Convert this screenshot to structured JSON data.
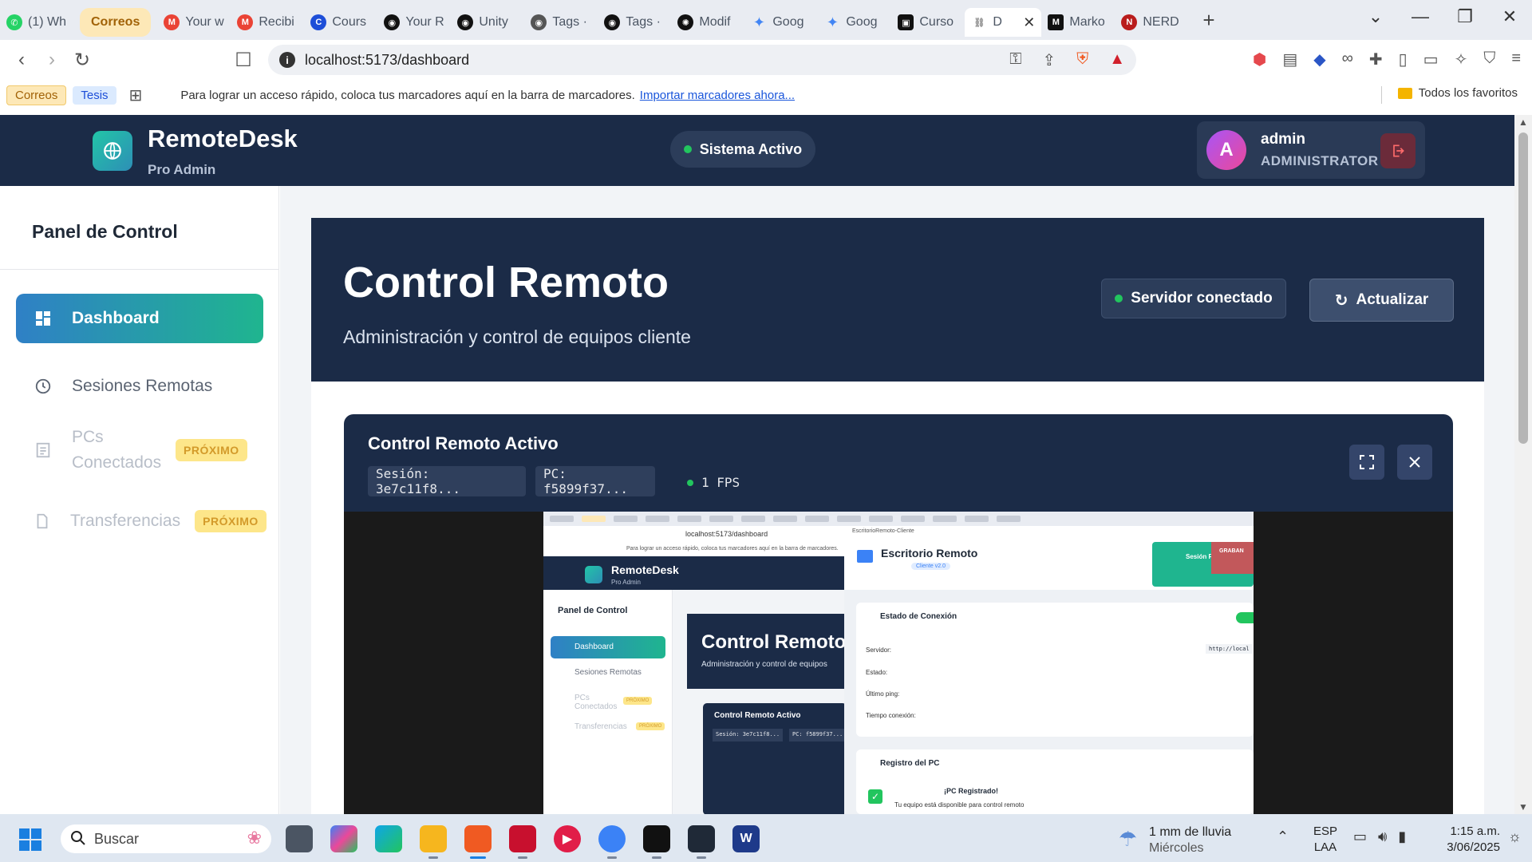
{
  "browser": {
    "tabs": [
      {
        "label": "(1) Wh",
        "icon": "whatsapp-icon",
        "color": "#25d366"
      },
      {
        "label": "Correos",
        "group": true
      },
      {
        "label": "Your w",
        "icon": "gmail-icon",
        "color": "#ea4335"
      },
      {
        "label": "Recibi",
        "icon": "gmail-icon",
        "color": "#ea4335"
      },
      {
        "label": "Cours",
        "icon": "coursera-icon",
        "color": "#1d4ed8"
      },
      {
        "label": "Your R",
        "icon": "github-icon",
        "color": "#111"
      },
      {
        "label": "Unity",
        "icon": "github-icon",
        "color": "#111"
      },
      {
        "label": "Tags ·",
        "icon": "github-icon",
        "color": "#555"
      },
      {
        "label": "Tags ·",
        "icon": "github-icon",
        "color": "#111"
      },
      {
        "label": "Modif",
        "icon": "openai-icon",
        "color": "#111"
      },
      {
        "label": "Goog",
        "icon": "gemini-icon",
        "color": "#4285f4"
      },
      {
        "label": "Goog",
        "icon": "gemini-icon",
        "color": "#4285f4"
      },
      {
        "label": "Curso",
        "icon": "cursor-icon",
        "color": "#111"
      },
      {
        "label": "D",
        "icon": "link-icon",
        "color": "#999",
        "active": true
      },
      {
        "label": "Marko",
        "icon": "medium-icon",
        "color": "#111"
      },
      {
        "label": "NERD",
        "icon": "nerd-icon",
        "color": "#b91c1c"
      }
    ],
    "url": "localhost:5173/dashboard",
    "bookmarks": {
      "chip1": "Correos",
      "chip2": "Tesis",
      "text": "Para lograr un acceso rápido, coloca tus marcadores aquí en la barra de marcadores.",
      "link": "Importar marcadores ahora...",
      "favorites": "Todos los favoritos"
    }
  },
  "header": {
    "brand": "RemoteDesk",
    "brand_sub": "Pro Admin",
    "status": "Sistema Activo",
    "user_initial": "A",
    "user_name": "admin",
    "user_role": "ADMINISTRATOR"
  },
  "sidebar": {
    "title": "Panel de Control",
    "items": [
      {
        "label": "Dashboard",
        "icon": "dashboard-icon",
        "active": true
      },
      {
        "label": "Sesiones Remotas",
        "icon": "clock-icon"
      },
      {
        "label": "PCs Conectados",
        "icon": "document-icon",
        "badge": "PRÓXIMO",
        "disabled": true
      },
      {
        "label": "Transferencias",
        "icon": "file-icon",
        "badge": "PRÓXIMO",
        "disabled": true
      }
    ]
  },
  "hero": {
    "title": "Control Remoto",
    "subtitle": "Administración y control de equipos cliente",
    "server_status": "Servidor conectado",
    "refresh_label": "Actualizar"
  },
  "remote": {
    "title": "Control Remoto Activo",
    "session": "Sesión: 3e7c11f8...",
    "pc": "PC: f5899f37...",
    "fps": "1 FPS"
  },
  "preview": {
    "url": "localhost:5173/dashboard",
    "bookmarks": "Para lograr un acceso rápido, coloca tus marcadores aquí en la barra de marcadores.",
    "brand": "RemoteDesk",
    "brand_sub": "Pro Admin",
    "side_title": "Panel de Control",
    "side_active": "Dashboard",
    "side_items": [
      "Sesiones Remotas",
      "PCs Conectados",
      "Transferencias"
    ],
    "badge": "PRÓXIMO",
    "hero_title": "Control Remoto",
    "hero_sub": "Administración y control de equipos",
    "card_title": "Control Remoto Activo",
    "chip_ses": "Sesión: 3e7c11f8...",
    "chip_pc": "PC: f5899f37...",
    "client": {
      "window_title": "EscritorioRemoto-Cliente",
      "title": "Escritorio Remoto",
      "version": "Cliente v2.0",
      "session": "Sesión Remota",
      "recording": "GRABAN",
      "conn_title": "Estado de Conexión",
      "server_label": "Servidor:",
      "server_value": "http://local",
      "state_label": "Estado:",
      "ping_label": "Último ping:",
      "time_label": "Tiempo conexión:",
      "reg_title": "Registro del PC",
      "reg_ok": "¡PC Registrado!",
      "reg_sub": "Tu equipo está disponible para control remoto"
    }
  },
  "taskbar": {
    "search": "Buscar",
    "weather_line1": "1 mm de lluvia",
    "weather_line2": "Miércoles",
    "lang1": "ESP",
    "lang2": "LAA",
    "time": "1:15 a.m.",
    "date": "3/06/2025"
  }
}
